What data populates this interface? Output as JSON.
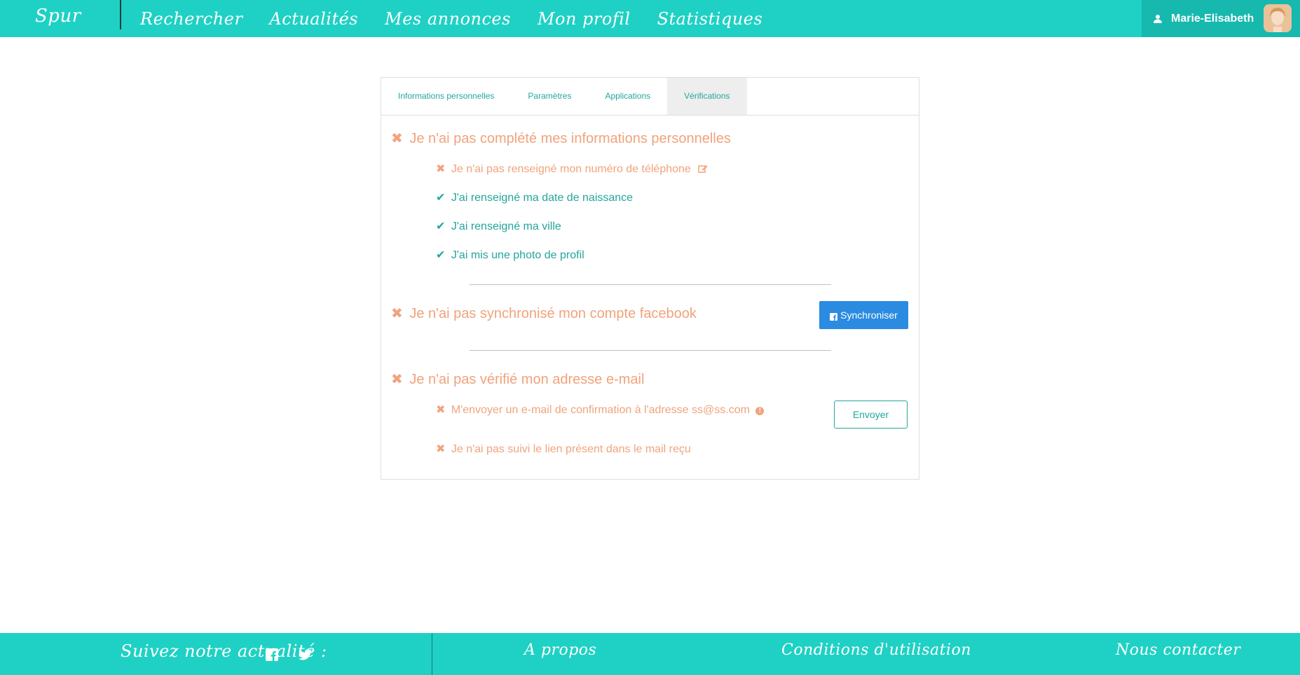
{
  "header": {
    "brand": "Spur",
    "nav": [
      "Rechercher",
      "Actualités",
      "Mes annonces",
      "Mon profil",
      "Statistiques"
    ],
    "user_name": "Marie-Elisabeth"
  },
  "tabs": [
    {
      "label": "Informations personnelles",
      "active": false
    },
    {
      "label": "Paramètres",
      "active": false
    },
    {
      "label": "Applications",
      "active": false
    },
    {
      "label": "Vérifications",
      "active": true
    }
  ],
  "sections": {
    "personal": {
      "title": "Je n'ai pas complété mes informations personnelles",
      "items": [
        {
          "text": "Je n'ai pas renseigné mon numéro de téléphone",
          "done": false
        },
        {
          "text": "J'ai renseigné ma date de naissance",
          "done": true
        },
        {
          "text": "J'ai renseigné ma ville",
          "done": true
        },
        {
          "text": "J'ai mis une photo de profil",
          "done": true
        }
      ]
    },
    "facebook": {
      "title": "Je n'ai pas synchronisé mon compte facebook",
      "button": "Synchroniser"
    },
    "email": {
      "title": "Je n'ai pas vérifié mon adresse e-mail",
      "items": [
        {
          "text": "M'envoyer un e-mail de confirmation à l'adresse ss@ss.com",
          "done": false
        },
        {
          "text": "Je n'ai pas suivi le lien présent dans le mail reçu",
          "done": false
        }
      ],
      "button": "Envoyer"
    }
  },
  "footer": {
    "follow": "Suivez notre actualité :",
    "links": [
      "A propos",
      "Conditions d'utilisation",
      "Nous contacter"
    ]
  },
  "icons": {
    "bad_mark": "✖",
    "good_mark": "✔",
    "info_mark": "!"
  },
  "colors": {
    "primary": "#1ed1c4",
    "primary_dark": "#17b8ad",
    "warning": "#f0a37c",
    "success": "#23a69c",
    "facebook_button": "#2a8be0"
  }
}
